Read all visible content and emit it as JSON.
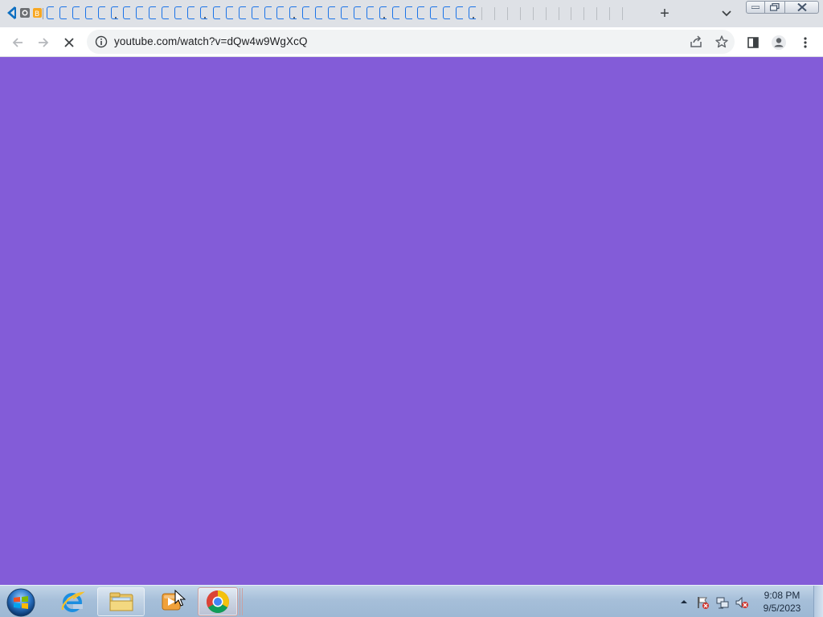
{
  "browser": {
    "tabs_count_visible": 46,
    "new_tab_label": "+",
    "address": {
      "url": "youtube.com/watch?v=dQw4w9WgXcQ"
    },
    "status": "loading"
  },
  "page": {
    "background_color": "#835cd8"
  },
  "taskbar": {
    "apps": [
      {
        "name": "internet-explorer",
        "pinned": false
      },
      {
        "name": "file-explorer",
        "pinned": true
      },
      {
        "name": "windows-media-player",
        "pinned": false
      },
      {
        "name": "google-chrome",
        "pinned": true,
        "active": true
      }
    ],
    "clock": {
      "time": "9:08 PM",
      "date": "9/5/2023"
    }
  },
  "colors": {
    "accent": "#1a73e8",
    "tabstrip": "#dee1e6",
    "omnibox": "#f1f3f4"
  }
}
